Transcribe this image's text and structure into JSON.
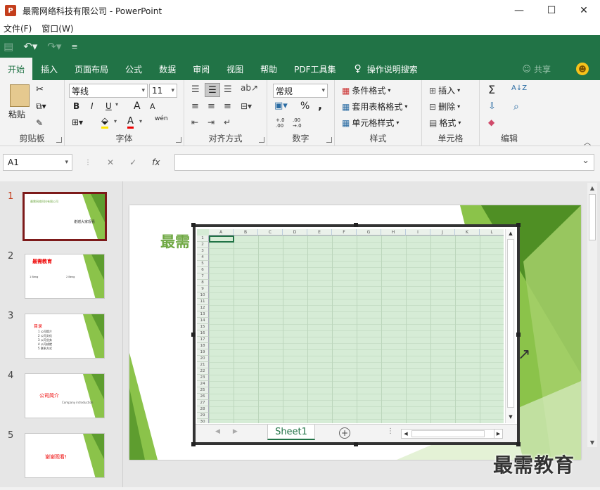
{
  "window": {
    "title": "最需网络科技有限公司 - PowerPoint",
    "app_icon": "P",
    "controls": [
      "—",
      "☐",
      "✕"
    ]
  },
  "menu": {
    "items": [
      "文件(F)",
      "窗口(W)"
    ]
  },
  "qat": {
    "save": "💾",
    "undo": "↶▾",
    "redo": "↷▾",
    "customize": "≡"
  },
  "tabs": {
    "items": [
      "开始",
      "插入",
      "页面布局",
      "公式",
      "数据",
      "审阅",
      "视图",
      "帮助",
      "PDF工具集"
    ],
    "active": "开始",
    "tell_me": "操作说明搜索",
    "share": "共享"
  },
  "ribbon": {
    "clipboard": {
      "label": "剪贴板",
      "paste": "粘贴"
    },
    "font": {
      "label": "字体",
      "name": "等线",
      "size": "11",
      "bold": "B",
      "italic": "I",
      "underline": "U",
      "grow": "A",
      "shrink": "A",
      "wen": "wén",
      "font_color": "A"
    },
    "alignment": {
      "label": "对齐方式"
    },
    "number": {
      "label": "数字",
      "format": "常规",
      "percent": "%",
      "comma": ",",
      "inc": "+.0 .00",
      "dec": ".00 →.0"
    },
    "styles": {
      "label": "样式",
      "conditional": "条件格式",
      "table": "套用表格格式",
      "cell": "单元格样式"
    },
    "cells": {
      "label": "单元格",
      "insert": "插入",
      "delete": "删除",
      "format": "格式"
    },
    "editing": {
      "label": "编辑",
      "sum": "Σ",
      "sort": "A↓Z",
      "fill": "⇩",
      "find": "⌕",
      "clear": "◆"
    }
  },
  "formula_bar": {
    "name_box": "A1",
    "cancel": "✕",
    "enter": "✓",
    "fx": "fx",
    "value": ""
  },
  "thumbnails": [
    {
      "num": "1",
      "lines": [
        "最需网络科技有限公司",
        "谢谢大家观看"
      ]
    },
    {
      "num": "2",
      "lines": [
        "最需教育",
        "1 Beng",
        "2 Beng"
      ]
    },
    {
      "num": "3",
      "lines": [
        "目录",
        "1 公司简介",
        "2 公司文化",
        "3 公司业务",
        "4 公司成就",
        "5 联系方式"
      ]
    },
    {
      "num": "4",
      "lines": [
        "公司简介",
        "Company introduction"
      ]
    },
    {
      "num": "5",
      "lines": [
        "谢谢观看!"
      ]
    }
  ],
  "slide": {
    "title_visible": "最需",
    "right_text": "↗"
  },
  "spreadsheet": {
    "columns": [
      "A",
      "B",
      "C",
      "D",
      "E",
      "F",
      "G",
      "H",
      "I",
      "J",
      "K",
      "L"
    ],
    "rows": [
      "1",
      "2",
      "3",
      "4",
      "5",
      "6",
      "7",
      "8",
      "9",
      "10",
      "11",
      "12",
      "13",
      "14",
      "15",
      "16",
      "17",
      "18",
      "19",
      "20",
      "21",
      "22",
      "23",
      "24",
      "25",
      "26",
      "27",
      "28",
      "29",
      "30"
    ],
    "sheet_tab": "Sheet1",
    "add_sheet": "+"
  },
  "watermark": "最需教育",
  "colors": {
    "excel_green": "#217346",
    "slide_green": "#6fa843",
    "selected_thumb": "#7d1a1a"
  }
}
